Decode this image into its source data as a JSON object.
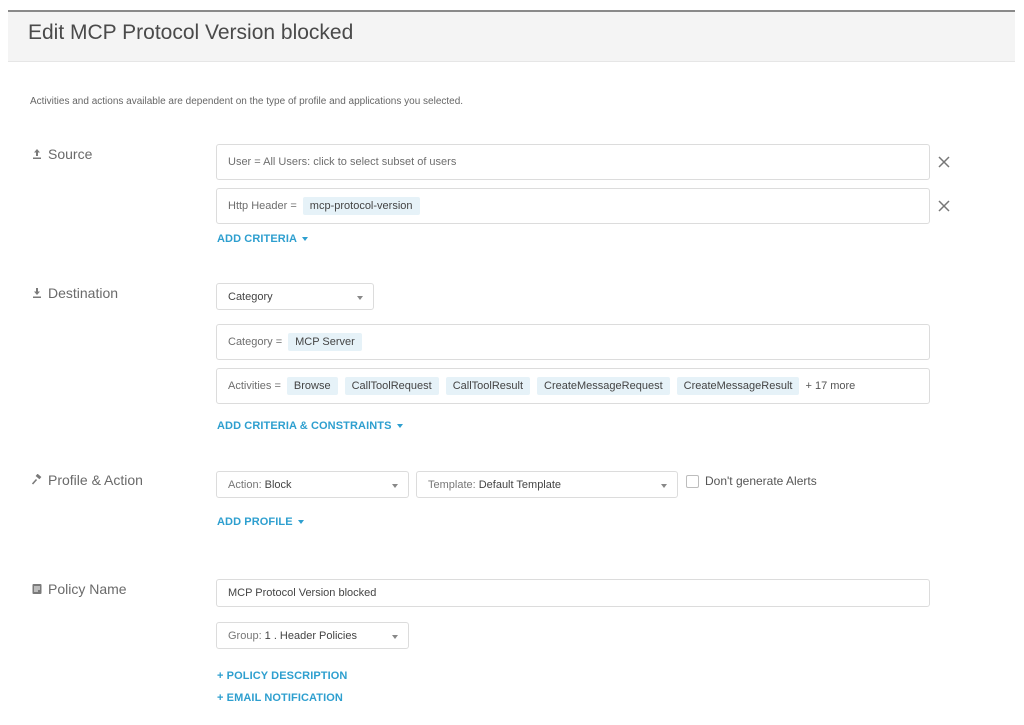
{
  "header": {
    "title": "Edit MCP Protocol Version blocked"
  },
  "intro": "Activities and actions available are dependent on the type of profile and applications you selected.",
  "source": {
    "label": "Source",
    "user_field": "User = All Users: click to select subset of users",
    "http_header": {
      "key": "Http Header =",
      "value": "mcp-protocol-version"
    },
    "add_criteria": "ADD CRITERIA"
  },
  "destination": {
    "label": "Destination",
    "type_select": "Category",
    "category": {
      "key": "Category =",
      "value": "MCP Server"
    },
    "activities": {
      "key": "Activities =",
      "items": [
        "Browse",
        "CallToolRequest",
        "CallToolResult",
        "CreateMessageRequest",
        "CreateMessageResult"
      ],
      "more": "+ 17 more"
    },
    "add_criteria": "ADD CRITERIA & CONSTRAINTS"
  },
  "profile_action": {
    "label": "Profile & Action",
    "action": {
      "label": "Action:",
      "value": "Block"
    },
    "template": {
      "label": "Template:",
      "value": "Default Template"
    },
    "alerts_checkbox": "Don't generate Alerts",
    "add_profile": "ADD PROFILE"
  },
  "policy_name": {
    "label": "Policy Name",
    "value": "MCP Protocol Version blocked",
    "group": {
      "label": "Group:",
      "value": "1 . Header Policies"
    },
    "description_link": "+ POLICY DESCRIPTION",
    "email_link": "+ EMAIL NOTIFICATION"
  },
  "colors": {
    "accent": "#2e9fcf",
    "chip_bg": "#e6f2f8",
    "header_bg": "#f4f4f4"
  }
}
